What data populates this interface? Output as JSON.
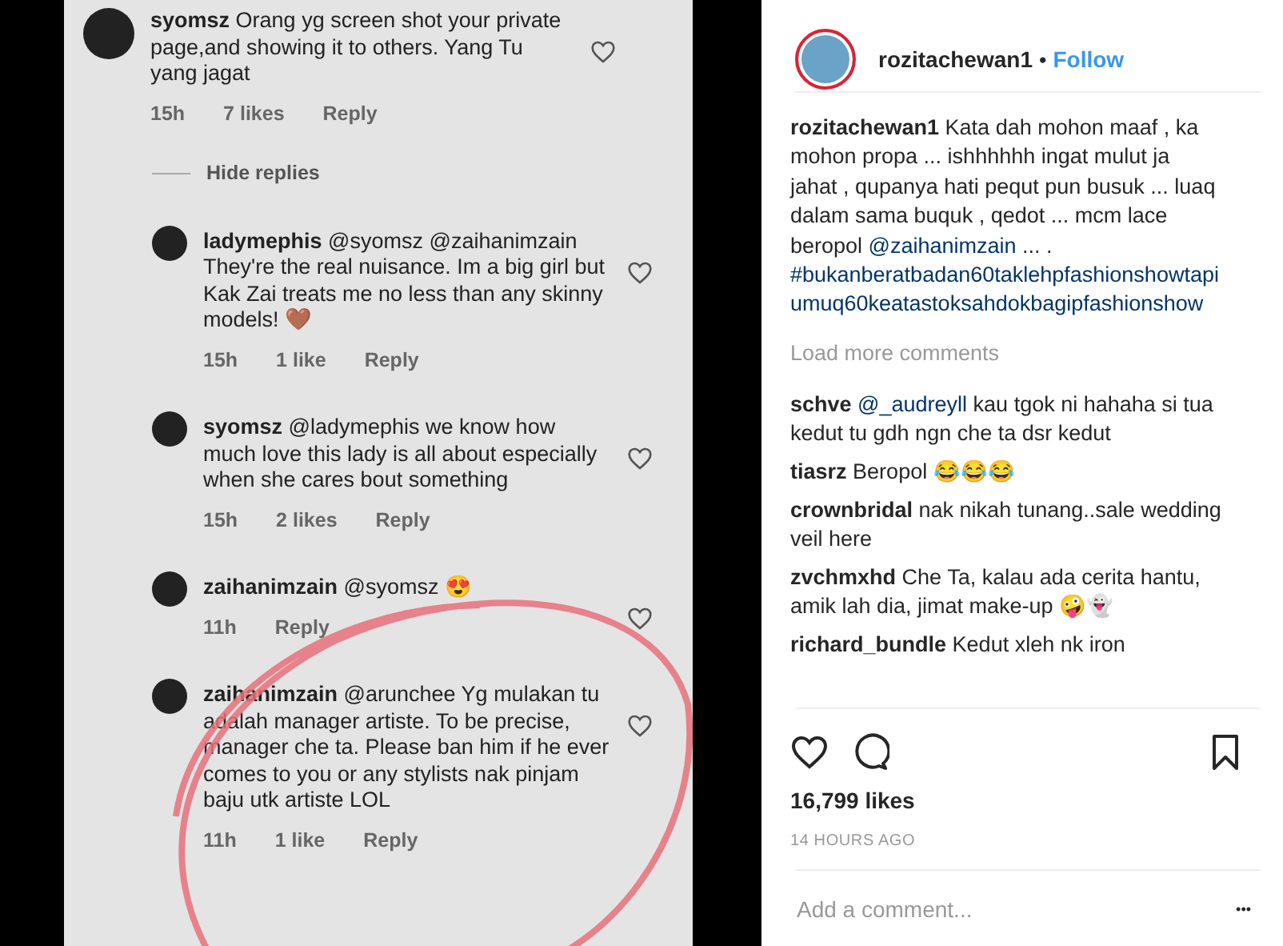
{
  "post_image": {
    "comments": [
      {
        "user": "syomsz",
        "text": "Orang yg screen shot your private page,and showing it to others. Yang Tu yang jagat",
        "time": "15h",
        "likes": "7 likes",
        "reply": "Reply",
        "hide_replies": "Hide replies",
        "replies": [
          {
            "user": "ladymephis",
            "text": "@syomsz @zaihanimzain They're the real nuisance. Im a big girl but Kak Zai treats me no less than any skinny models! 🤎",
            "time": "15h",
            "likes": "1 like",
            "reply": "Reply"
          },
          {
            "user": "syomsz",
            "text": "@ladymephis we know how much love this lady is all about especially when she cares bout something",
            "time": "15h",
            "likes": "2 likes",
            "reply": "Reply"
          },
          {
            "user": "zaihanimzain",
            "text": "@syomsz 😍",
            "time": "11h",
            "reply": "Reply"
          },
          {
            "user": "zaihanimzain",
            "text": "@arunchee Yg mulakan tu adalah manager artiste. To be precise, manager che ta. Please ban him if he ever comes to you or any stylists nak pinjam baju utk artiste LOL",
            "time": "11h",
            "likes": "1 like",
            "reply": "Reply"
          }
        ]
      }
    ]
  },
  "header": {
    "user": "rozitachewan1",
    "separator": "•",
    "follow": "Follow"
  },
  "caption": {
    "user": "rozitachewan1",
    "segments": [
      {
        "kind": "text",
        "text": "Kata dah mohon maaf , ka mohon propa ... ishhhhhh ingat mulut ja jahat , qupanya hati pequt pun busuk ... luaq dalam sama buquk , qedot ... mcm lace beropol "
      },
      {
        "kind": "link",
        "text": "@zaihanimzain"
      },
      {
        "kind": "text",
        "text": " ... . "
      },
      {
        "kind": "link",
        "text": "#bukanberatbadan60taklehpfashionshowtapiumuq60keatastoksahdokbagipfashionshow"
      }
    ]
  },
  "load_more": "Load more comments",
  "comments": [
    {
      "user": "schve",
      "segments": [
        {
          "kind": "link",
          "text": "@_audreyll"
        },
        {
          "kind": "text",
          "text": " kau tgok ni hahaha si tua kedut tu gdh ngn che ta dsr kedut"
        }
      ]
    },
    {
      "user": "tiasrz",
      "segments": [
        {
          "kind": "text",
          "text": "Beropol 😂😂😂"
        }
      ]
    },
    {
      "user": "crownbridal",
      "segments": [
        {
          "kind": "text",
          "text": "nak nikah tunang..sale wedding veil here"
        }
      ]
    },
    {
      "user": "zvchmxhd",
      "segments": [
        {
          "kind": "text",
          "text": "Che Ta, kalau ada cerita hantu, amik lah dia, jimat make-up 🤪👻"
        }
      ]
    },
    {
      "user": "richard_bundle",
      "segments": [
        {
          "kind": "text",
          "text": "Kedut xleh nk iron"
        }
      ]
    }
  ],
  "likes": "16,799 likes",
  "time_ago": "14 HOURS AGO",
  "comment_field": {
    "placeholder": "Add a comment..."
  },
  "more": "•••"
}
